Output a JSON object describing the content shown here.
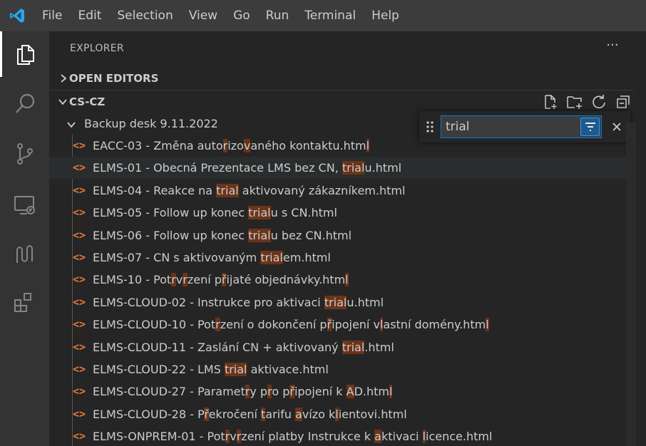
{
  "menu": {
    "items": [
      "File",
      "Edit",
      "Selection",
      "View",
      "Go",
      "Run",
      "Terminal",
      "Help"
    ]
  },
  "activity": {
    "icons": [
      "files-icon",
      "search-icon",
      "source-control-icon",
      "remote-explorer-icon",
      "gitlens-icon",
      "extensions-icon"
    ]
  },
  "explorer": {
    "title": "EXPLORER",
    "more": "···",
    "open_editors": "OPEN EDITORS",
    "root": "CS-CZ",
    "folder": "Backup desk 9.11.2022"
  },
  "find": {
    "value": "trial"
  },
  "files": [
    {
      "segments": [
        [
          "EACC-03 - Změna auto",
          0
        ],
        [
          "r",
          1
        ],
        [
          "izo",
          0
        ],
        [
          "v",
          1
        ],
        [
          "aného kontaktu.htm",
          0
        ],
        [
          "l",
          1
        ]
      ]
    },
    {
      "segments": [
        [
          "ELMS-01 - Obecná Prezentace LMS bez CN, ",
          0
        ],
        [
          "trial",
          1
        ],
        [
          "u.html",
          0
        ]
      ]
    },
    {
      "segments": [
        [
          "ELMS-04 - Reakce na ",
          0
        ],
        [
          "trial",
          1
        ],
        [
          " aktivovaný zákazníkem.html",
          0
        ]
      ]
    },
    {
      "segments": [
        [
          "ELMS-05 - Follow up konec ",
          0
        ],
        [
          "trial",
          1
        ],
        [
          "u s CN.html",
          0
        ]
      ]
    },
    {
      "segments": [
        [
          "ELMS-06 - Follow up konec ",
          0
        ],
        [
          "trial",
          1
        ],
        [
          "u bez CN.html",
          0
        ]
      ]
    },
    {
      "segments": [
        [
          "ELMS-07 - CN s aktivovaným ",
          0
        ],
        [
          "trial",
          1
        ],
        [
          "em.html",
          0
        ]
      ]
    },
    {
      "segments": [
        [
          "ELMS-10 - Pot",
          0
        ],
        [
          "r",
          1
        ],
        [
          "v",
          0
        ],
        [
          "r",
          1
        ],
        [
          "zení p",
          0
        ],
        [
          "ř",
          1
        ],
        [
          "ijaté objednávky.htm",
          0
        ],
        [
          "l",
          1
        ]
      ]
    },
    {
      "segments": [
        [
          "ELMS-CLOUD-02 - Instrukce pro aktivaci ",
          0
        ],
        [
          "trial",
          1
        ],
        [
          "u.html",
          0
        ]
      ]
    },
    {
      "segments": [
        [
          "ELMS-CLOUD-10 - Pot",
          0
        ],
        [
          "r",
          1
        ],
        [
          "zení o dokončení p",
          0
        ],
        [
          "ř",
          1
        ],
        [
          "ipojení v",
          0
        ],
        [
          "l",
          1
        ],
        [
          "astní domény.htm",
          0
        ],
        [
          "l",
          1
        ]
      ]
    },
    {
      "segments": [
        [
          "ELMS-CLOUD-11 - Zaslání CN + aktivovaný ",
          0
        ],
        [
          "trial",
          1
        ],
        [
          ".html",
          0
        ]
      ]
    },
    {
      "segments": [
        [
          "ELMS-CLOUD-22 - LMS ",
          0
        ],
        [
          "trial",
          1
        ],
        [
          " aktivace.html",
          0
        ]
      ]
    },
    {
      "segments": [
        [
          "ELMS-CLOUD-27 - Paramet",
          0
        ],
        [
          "r",
          1
        ],
        [
          "y p",
          0
        ],
        [
          "r",
          1
        ],
        [
          "o p",
          0
        ],
        [
          "ř",
          1
        ],
        [
          "ipojení k ",
          0
        ],
        [
          "A",
          1
        ],
        [
          "D.htm",
          0
        ],
        [
          "l",
          1
        ]
      ]
    },
    {
      "segments": [
        [
          "ELMS-CLOUD-28 - P",
          0
        ],
        [
          "ř",
          1
        ],
        [
          "ekročení ",
          0
        ],
        [
          "t",
          1
        ],
        [
          "arifu ",
          0
        ],
        [
          "a",
          1
        ],
        [
          "vízo k",
          0
        ],
        [
          "l",
          1
        ],
        [
          "ientovi.html",
          0
        ]
      ]
    },
    {
      "segments": [
        [
          "ELMS-ONPREM-01 - Pot",
          0
        ],
        [
          "r",
          1
        ],
        [
          "v",
          0
        ],
        [
          "r",
          1
        ],
        [
          "zení platby Instrukce k ",
          0
        ],
        [
          "a",
          1
        ],
        [
          "ktivaci ",
          0
        ],
        [
          "l",
          1
        ],
        [
          "icence.html",
          0
        ]
      ]
    }
  ],
  "colors": {
    "accent": "#007fd4",
    "file_icon": "#e37933",
    "highlight": "#6b3419"
  }
}
